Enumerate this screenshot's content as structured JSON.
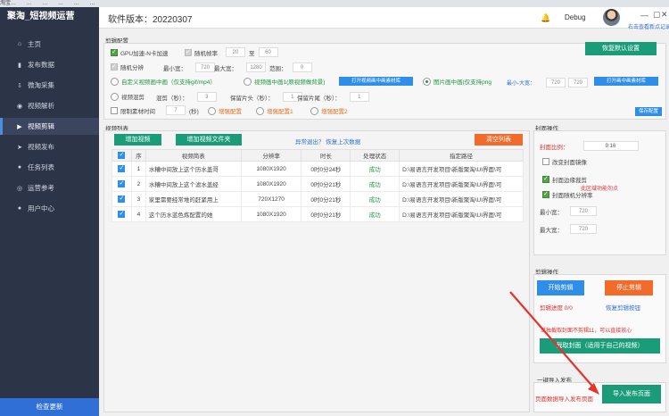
{
  "tabstrip": [
    "淘宝…",
    "…",
    "…",
    "…",
    "…",
    "…"
  ],
  "brand": "聚淘_短视频运营",
  "sidebar": {
    "items": [
      {
        "label": "主页",
        "icon": "home-icon"
      },
      {
        "label": "发布数据",
        "icon": "bar-chart-icon"
      },
      {
        "label": "微淘采集",
        "icon": "download-icon"
      },
      {
        "label": "视频解析",
        "icon": "play-circle-icon"
      },
      {
        "label": "视频剪辑",
        "icon": "play-square-icon"
      },
      {
        "label": "视频发布",
        "icon": "send-icon"
      },
      {
        "label": "任务列表",
        "icon": "user-icon"
      },
      {
        "label": "运营参考",
        "icon": "money-icon"
      },
      {
        "label": "用户中心",
        "icon": "person-icon"
      }
    ],
    "active_index": 4,
    "check_update": "检查更新"
  },
  "header": {
    "version": "软件版本：20220307",
    "user": "Debug",
    "tip": "右击查看新点记录"
  },
  "edit_config": {
    "title": "剪辑配置",
    "gpu_label": "GPU加速-N卡加速",
    "random_frame_label": "随机帧率",
    "frame_from": "20",
    "to_label": "至",
    "frame_to": "60",
    "random_split_label": "随机分辨",
    "min_width_label": "最小宽：",
    "min_width": "720",
    "max_width_label": "最大宽：",
    "max_width": "1280",
    "range_label": "范围：",
    "range": "0",
    "custom_overlay_label": "自定义视频画中画（仅支持gif/mp4）",
    "overlay1_label": "视频画中画1(原视频做背景)",
    "open_overlay_btn": "打开视频画中画素材库",
    "image_overlay_label": "图片画中画(仅支持png",
    "min_size_label": "最小-大宽：",
    "size_min": "720",
    "size_max": "720",
    "open_image_btn": "打开画中画素材库",
    "restore_btn": "恢复默认设置",
    "mix_label": "视频混剪",
    "blend_label": "混剪（秒）：",
    "blend": "3",
    "keep_head_label": "保留片头（秒）：",
    "keep_head": "1",
    "keep_tail_label": "保留片尾（秒）：",
    "keep_tail": "1",
    "limit_label": "限制素材时间",
    "limit": "7",
    "seconds_label": "(秒)",
    "enhance_label": "增强配置",
    "enhance1_label": "增强配置1",
    "enhance2_label": "增强配置2",
    "save_btn": "保存配置"
  },
  "video_list": {
    "title": "视频列表",
    "add_video": "增加视频",
    "add_folder": "增加视频文件夹",
    "recover_hint": "异常退出？ 恢复上次数据",
    "clear_list": "清空列表",
    "columns": [
      "",
      "序",
      "视频简表",
      "分辨率",
      "时长",
      "处理状态",
      "指定路径"
    ],
    "rows": [
      {
        "index": "1",
        "name": "水糟中间放上这个历水盖哥",
        "res": "1080X1920",
        "dur": "0时0分24秒",
        "status": "成功",
        "path": "D:\\易语言开发项目\\新版聚淘\\UI界面\\可"
      },
      {
        "index": "2",
        "name": "水糟中间放上这个滤水盖经",
        "res": "1080X1920",
        "dur": "0时0分21秒",
        "status": "成功",
        "path": "D:\\易语言开发项目\\新版聚淘\\UI界面\\可"
      },
      {
        "index": "3",
        "name": "家里需要经常堆的赶紧用上",
        "res": "720X1270",
        "dur": "0时0分21秒",
        "status": "成功",
        "path": "D:\\易语言开发项目\\新版聚淘\\UI界面\\可"
      },
      {
        "index": "4",
        "name": "这个历水蓝色炼配置的她",
        "res": "1080X1920",
        "dur": "0时0分21秒",
        "status": "成功",
        "path": "D:\\易语言开发项目\\新版聚淘\\UI界面\\可"
      }
    ]
  },
  "cover": {
    "title": "封面操作",
    "ratio_label": "封面比例：",
    "ratio": "9:16",
    "mirror_label": "改变封面镜像",
    "edge_label": "封面边缘裁剪",
    "color_label": "封面随机分辨率",
    "hint": "此区域功能勿点",
    "min_w_label": "最小宽：",
    "min_w": "720",
    "max_w_label": "最大宽：",
    "max_w": "720"
  },
  "edit_ops": {
    "title": "剪辑操作",
    "start": "开始剪辑",
    "stop": "停止剪辑",
    "progress": "剪辑进度 0/0",
    "restore_btn": "恢复剪辑按钮",
    "note": "单独截取封面不剪辑11，可以直接放心",
    "capture": "截取封面（适用于自己的视频）"
  },
  "publish": {
    "title": "一键导入发布",
    "hint": "页面数据导入发布页面",
    "import_btn": "导入发布页面"
  }
}
